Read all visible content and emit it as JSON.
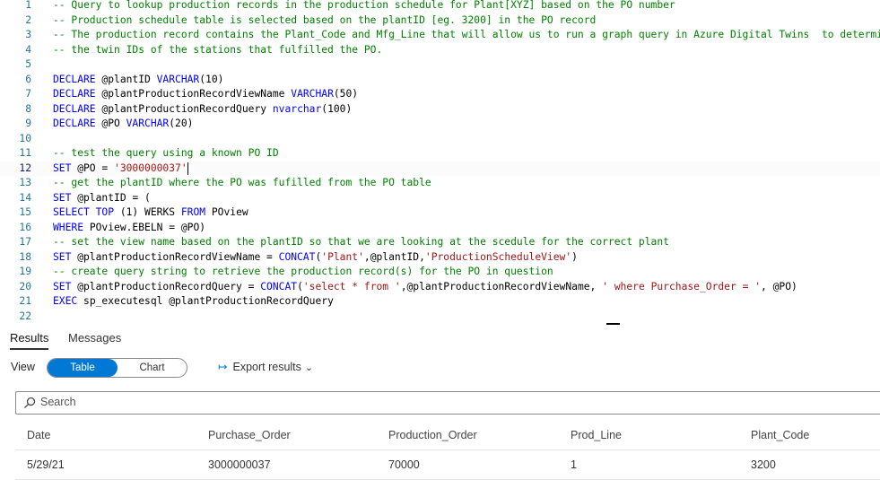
{
  "editor": {
    "current_line": 12,
    "lines": [
      {
        "n": "1",
        "tokens": [
          {
            "t": "-- Query to lookup production records in the production schedule for Plant[XYZ] based on the PO number",
            "c": "comment"
          }
        ]
      },
      {
        "n": "2",
        "tokens": [
          {
            "t": "-- Production schedule table is selected based on the plantID [eg. 3200] in the PO record",
            "c": "comment"
          }
        ]
      },
      {
        "n": "3",
        "tokens": [
          {
            "t": "-- The production record contains the Plant_Code and Mfg_Line that will allow us to run a graph query in Azure Digital Twins  to determine",
            "c": "comment"
          }
        ]
      },
      {
        "n": "4",
        "tokens": [
          {
            "t": "-- the twin IDs of the stations that fulfilled the PO.",
            "c": "comment"
          }
        ]
      },
      {
        "n": "5",
        "tokens": []
      },
      {
        "n": "6",
        "tokens": [
          {
            "t": "DECLARE",
            "c": "kw"
          },
          {
            "t": " @plantID ",
            "c": "id"
          },
          {
            "t": "VARCHAR",
            "c": "kw"
          },
          {
            "t": "(10)",
            "c": "id"
          }
        ]
      },
      {
        "n": "7",
        "tokens": [
          {
            "t": "DECLARE",
            "c": "kw"
          },
          {
            "t": " @plantProductionRecordViewName ",
            "c": "id"
          },
          {
            "t": "VARCHAR",
            "c": "kw"
          },
          {
            "t": "(50)",
            "c": "id"
          }
        ]
      },
      {
        "n": "8",
        "tokens": [
          {
            "t": "DECLARE",
            "c": "kw"
          },
          {
            "t": " @plantProductionRecordQuery ",
            "c": "id"
          },
          {
            "t": "nvarchar",
            "c": "kw"
          },
          {
            "t": "(100)",
            "c": "id"
          }
        ]
      },
      {
        "n": "9",
        "tokens": [
          {
            "t": "DECLARE",
            "c": "kw"
          },
          {
            "t": " @PO ",
            "c": "id"
          },
          {
            "t": "VARCHAR",
            "c": "kw"
          },
          {
            "t": "(20)",
            "c": "id"
          }
        ]
      },
      {
        "n": "10",
        "tokens": []
      },
      {
        "n": "11",
        "tokens": [
          {
            "t": "-- test the query using a known PO ID",
            "c": "comment"
          }
        ]
      },
      {
        "n": "12",
        "tokens": [
          {
            "t": "SET",
            "c": "kw"
          },
          {
            "t": " @PO = ",
            "c": "id"
          },
          {
            "t": "'3000000037'",
            "c": "str"
          }
        ]
      },
      {
        "n": "13",
        "tokens": [
          {
            "t": "-- get the plantID where the PO was fufilled from the PO table",
            "c": "comment"
          }
        ]
      },
      {
        "n": "14",
        "tokens": [
          {
            "t": "SET",
            "c": "kw"
          },
          {
            "t": " @plantID = (",
            "c": "id"
          }
        ]
      },
      {
        "n": "15",
        "tokens": [
          {
            "t": "SELECT",
            "c": "kw"
          },
          {
            "t": " ",
            "c": "id"
          },
          {
            "t": "TOP",
            "c": "kw"
          },
          {
            "t": " (1) WERKS ",
            "c": "id"
          },
          {
            "t": "FROM",
            "c": "kw"
          },
          {
            "t": " POview",
            "c": "id"
          }
        ]
      },
      {
        "n": "16",
        "tokens": [
          {
            "t": "WHERE",
            "c": "kw"
          },
          {
            "t": " POview.EBELN = @PO)",
            "c": "id"
          }
        ]
      },
      {
        "n": "17",
        "tokens": [
          {
            "t": "-- set the view name based on the plantID so that we are looking at the scedule for the correct plant",
            "c": "comment"
          }
        ]
      },
      {
        "n": "18",
        "tokens": [
          {
            "t": "SET",
            "c": "kw"
          },
          {
            "t": " @plantProductionRecordViewName = ",
            "c": "id"
          },
          {
            "t": "CONCAT",
            "c": "kw"
          },
          {
            "t": "(",
            "c": "id"
          },
          {
            "t": "'Plant'",
            "c": "str"
          },
          {
            "t": ",@plantID,",
            "c": "id"
          },
          {
            "t": "'ProductionScheduleView'",
            "c": "str"
          },
          {
            "t": ")",
            "c": "id"
          }
        ]
      },
      {
        "n": "19",
        "tokens": [
          {
            "t": "-- create query string to retrieve the production record(s) for the PO in question",
            "c": "comment"
          }
        ]
      },
      {
        "n": "20",
        "tokens": [
          {
            "t": "SET",
            "c": "kw"
          },
          {
            "t": " @plantProductionRecordQuery = ",
            "c": "id"
          },
          {
            "t": "CONCAT",
            "c": "kw"
          },
          {
            "t": "(",
            "c": "id"
          },
          {
            "t": "'select * from '",
            "c": "str"
          },
          {
            "t": ",@plantProductionRecordViewName, ",
            "c": "id"
          },
          {
            "t": "' where Purchase_Order = '",
            "c": "str"
          },
          {
            "t": ", @PO)",
            "c": "id"
          }
        ]
      },
      {
        "n": "21",
        "tokens": [
          {
            "t": "EXEC",
            "c": "kw"
          },
          {
            "t": " sp_executesql @plantProductionRecordQuery",
            "c": "id"
          }
        ]
      },
      {
        "n": "22",
        "tokens": []
      }
    ]
  },
  "result_tabs": {
    "results": "Results",
    "messages": "Messages"
  },
  "viewbar": {
    "view_label": "View",
    "table": "Table",
    "chart": "Chart",
    "export": "Export results"
  },
  "search": {
    "placeholder": "Search"
  },
  "grid": {
    "columns": [
      "Date",
      "Purchase_Order",
      "Production_Order",
      "Prod_Line",
      "Plant_Code"
    ],
    "rows": [
      [
        "5/29/21",
        "3000000037",
        "70000",
        "1",
        "3200"
      ]
    ]
  },
  "colors": {
    "accent": "#0078d4",
    "comment": "#008000",
    "keyword": "#0000ff",
    "string": "#a31515",
    "line_number": "#237893"
  }
}
